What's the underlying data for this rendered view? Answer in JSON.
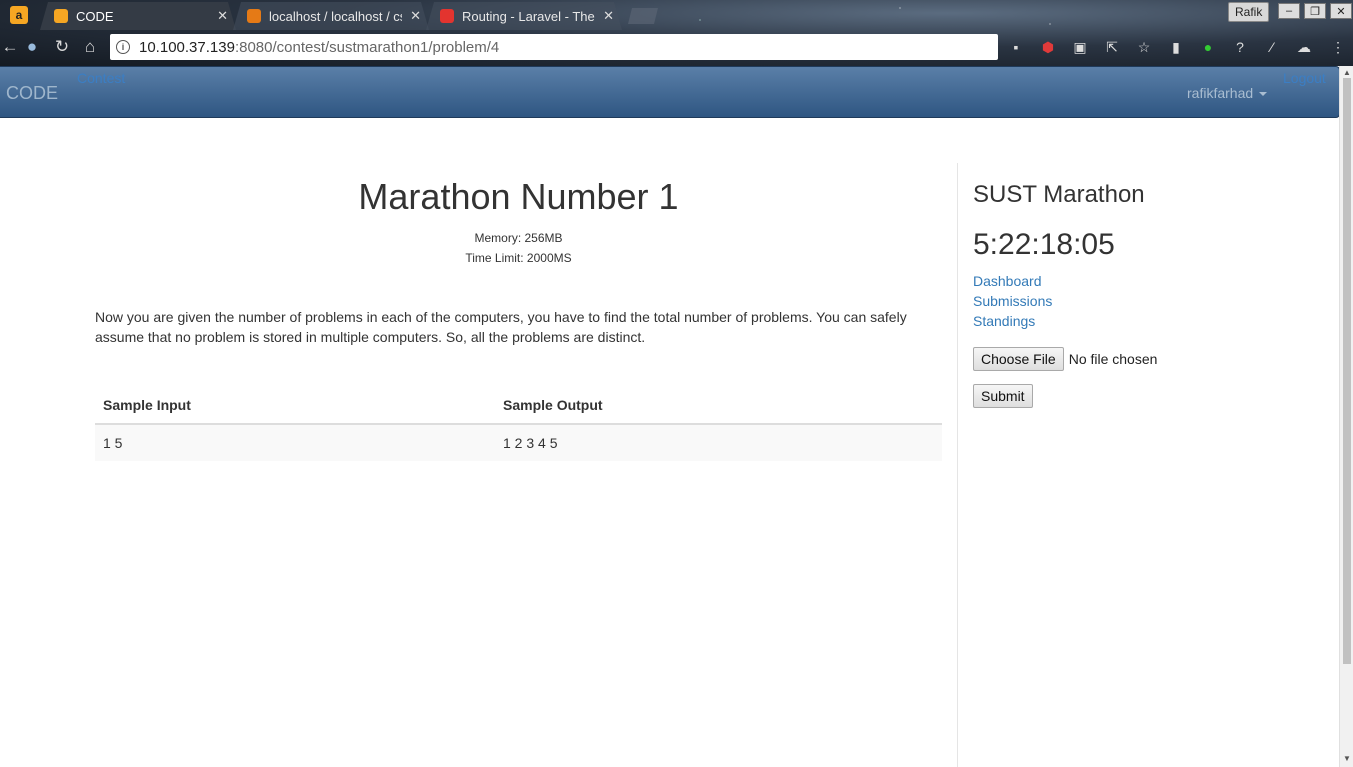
{
  "browser": {
    "tabs": [
      {
        "title": "CODE",
        "favicon_color": "#f5a623",
        "active": true
      },
      {
        "title": "localhost / localhost / cs",
        "favicon_color": "#e57a16",
        "active": false
      },
      {
        "title": "Routing - Laravel - The P",
        "favicon_color": "#e3342f",
        "active": false
      }
    ],
    "profile_name": "Rafik",
    "url_host": "10.100.37.139",
    "url_rest": ":8080/contest/sustmarathon1/problem/4"
  },
  "navbar": {
    "brand": "CODE",
    "contest_link": "Contest",
    "user": "rafikfarhad",
    "logout": "Logout"
  },
  "problem": {
    "title": "Marathon Number 1",
    "memory": "Memory: 256MB",
    "time_limit": "Time Limit: 2000MS",
    "statement": "Now you are given the number of problems in each of the computers, you have to find the total number of problems. You can safely assume that no problem is stored in multiple computers. So, all the problems are distinct.",
    "sample_headers": [
      "Sample Input",
      "Sample Output"
    ],
    "samples": [
      {
        "input": "1 5",
        "output": "1 2 3 4 5"
      }
    ]
  },
  "sidebar": {
    "contest_name": "SUST Marathon",
    "countdown": "5:22:18:05",
    "links": [
      "Dashboard",
      "Submissions",
      "Standings"
    ],
    "file_button": "Choose File",
    "file_status": "No file chosen",
    "submit": "Submit"
  }
}
